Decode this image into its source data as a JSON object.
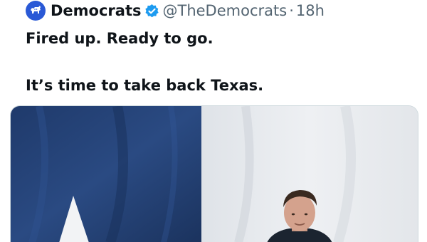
{
  "tweet": {
    "display_name": "Democrats",
    "handle": "@TheDemocrats",
    "separator": "·",
    "time": "18h",
    "line1": "Fired up. Ready to go.",
    "line2": "It’s time to take back Texas."
  },
  "icons": {
    "avatar": "democrats-donkey-icon",
    "verified": "verified-badge-icon"
  },
  "colors": {
    "avatar_bg": "#2a59d6",
    "verified": "#1d9bf0",
    "flag_blue": "#223f72",
    "flag_white": "#e9ebee"
  }
}
